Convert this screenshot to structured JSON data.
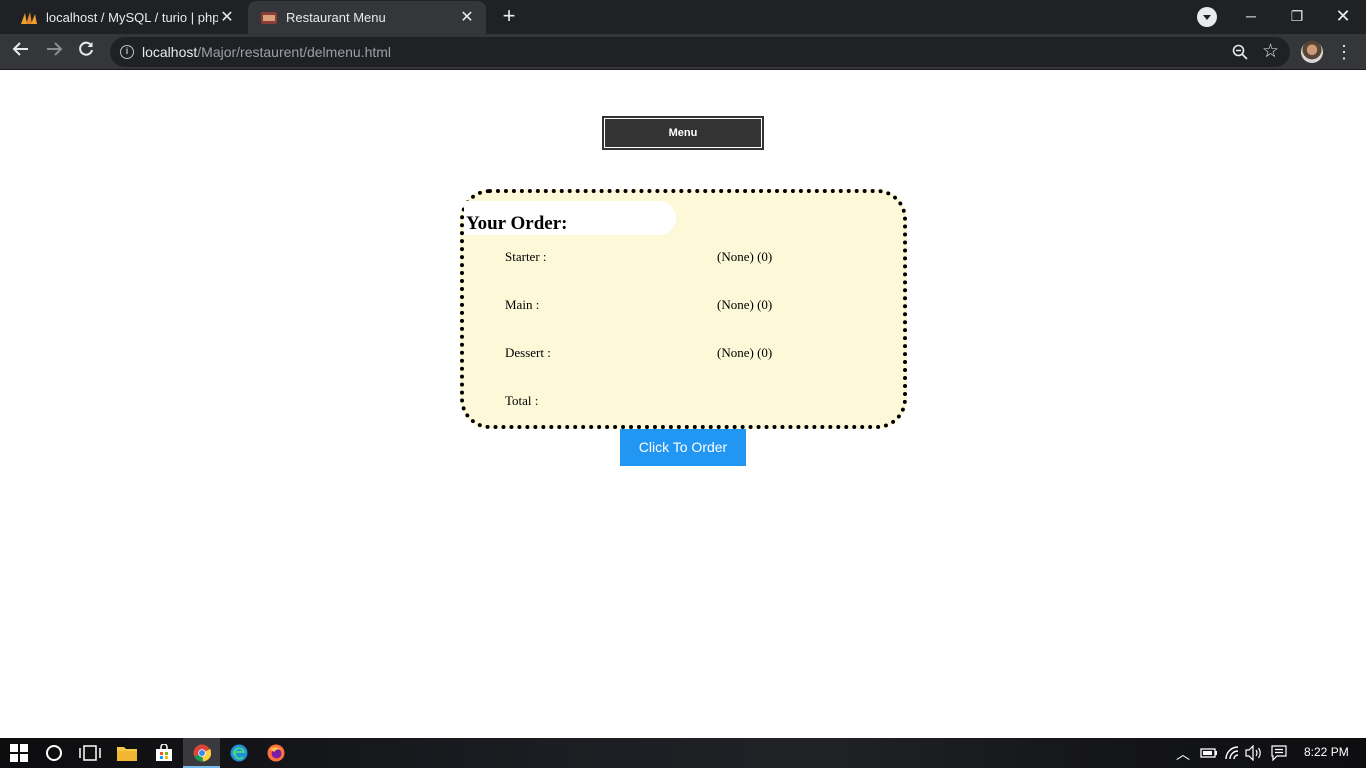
{
  "browser": {
    "tabs": [
      {
        "title": "localhost / MySQL / turio | phpM",
        "active": false
      },
      {
        "title": "Restaurant Menu",
        "active": true
      }
    ],
    "url": {
      "host": "localhost",
      "path": "/Major/restaurent/delmenu.html"
    }
  },
  "page": {
    "menu_button": "Menu",
    "order": {
      "title": "Your Order:",
      "rows": [
        {
          "label": "Starter :",
          "value": "(None) (0)"
        },
        {
          "label": "Main :",
          "value": "(None) (0)"
        },
        {
          "label": "Dessert :",
          "value": "(None) (0)"
        },
        {
          "label": "Total :",
          "value": ""
        }
      ]
    },
    "order_button": "Click To Order"
  },
  "taskbar": {
    "time": "8:22 PM"
  },
  "colors": {
    "order_button": "#2196f3",
    "menu_button": "#333333",
    "order_box_bg": "#fdf9d8"
  }
}
